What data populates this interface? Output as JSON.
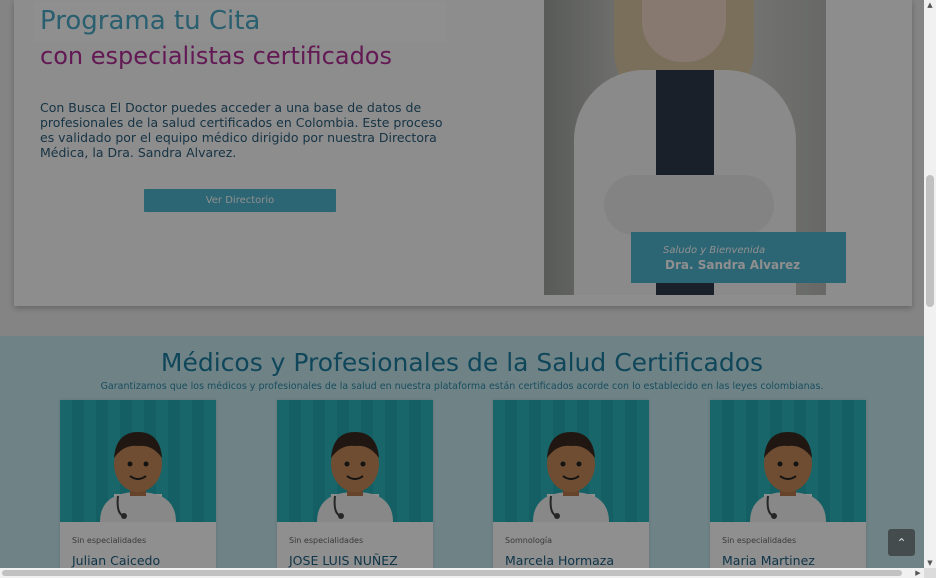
{
  "hero": {
    "title": "Programa tu Cita",
    "subtitle": "con especialistas certificados",
    "paragraph": "Con Busca El Doctor puedes acceder a una base de datos de profesionales de la salud certificados en Colombia. Este proceso es validado por el equipo médico dirigido por nuestra Directora Médica, la Dra. Sandra Alvarez.",
    "button_label": "Ver Directorio",
    "greeting_line1": "Saludo y Bienvenida",
    "greeting_line2": "Dra. Sandra Alvarez"
  },
  "section": {
    "title": "Médicos y Profesionales de la Salud Certificados",
    "subtitle": "Garantizamos que los médicos y profesionales de la salud en nuestra plataforma están certificados acorde con lo establecido en las leyes colombianas."
  },
  "doctors": [
    {
      "specialty": "Sin especialidades",
      "name": "Julian Caicedo"
    },
    {
      "specialty": "Sin especialidades",
      "name": "JOSE LUIS NUÑEZ"
    },
    {
      "specialty": "Somnología",
      "name": "Marcela Hormaza"
    },
    {
      "specialty": "Sin especialidades",
      "name": "Maria Martinez"
    }
  ],
  "scroll_top_icon": "chevron-up-icon",
  "colors": {
    "accent_blue": "#4fb4cf",
    "title_blue": "#4aa9c7",
    "magenta": "#b12d97",
    "card_teal": "#2bb6bd",
    "modal_overlay": "rgba(0,0,0,0.44)"
  }
}
